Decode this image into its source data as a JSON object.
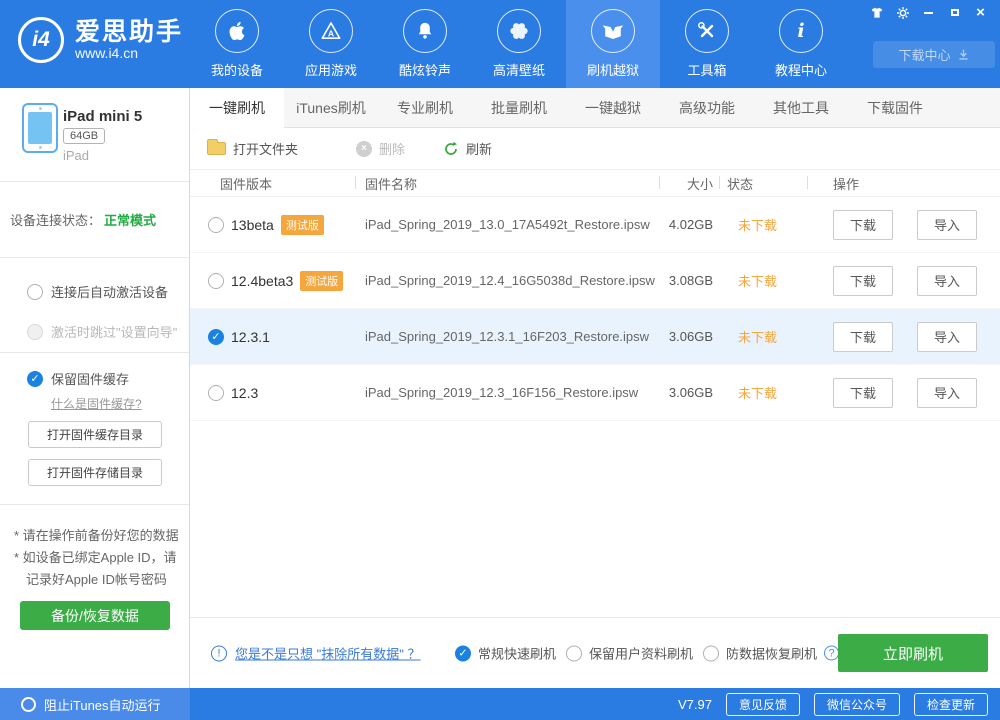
{
  "colors": {
    "accent_blue": "#2b7ce2",
    "nav_active_blue": "#4a8feb",
    "green": "#3cac46",
    "orange": "#f5a63c",
    "status_green": "#23ab44",
    "link_blue": "#3a7ad9",
    "selected_row": "#e9f3fd"
  },
  "header": {
    "brand": {
      "name": "爱思助手",
      "url": "www.i4.cn",
      "logo_text": "i4"
    },
    "nav": [
      {
        "label": "我的设备"
      },
      {
        "label": "应用游戏"
      },
      {
        "label": "酷炫铃声"
      },
      {
        "label": "高清壁纸"
      },
      {
        "label": "刷机越狱"
      },
      {
        "label": "工具箱"
      },
      {
        "label": "教程中心"
      }
    ],
    "download_center": "下载中心"
  },
  "sidebar": {
    "device": {
      "name": "iPad mini 5",
      "capacity": "64GB",
      "family": "iPad"
    },
    "connection_label": "设备连接状态：",
    "connection_status": "正常模式",
    "opt_auto_activate": "连接后自动激活设备",
    "opt_skip_wizard": "激活时跳过\"设置向导\"",
    "opt_keep_cache": "保留固件缓存",
    "cache_help_link": "什么是固件缓存?",
    "open_cache_btn": "打开固件缓存目录",
    "open_storage_btn": "打开固件存储目录",
    "note1": "* 请在操作前备份好您的数据",
    "note2": "* 如设备已绑定Apple ID，请",
    "note3": "记录好Apple ID帐号密码",
    "backup_btn": "备份/恢复数据",
    "block_itunes": "阻止iTunes自动运行"
  },
  "tabs": [
    {
      "label": "一键刷机"
    },
    {
      "label": "iTunes刷机"
    },
    {
      "label": "专业刷机"
    },
    {
      "label": "批量刷机"
    },
    {
      "label": "一键越狱"
    },
    {
      "label": "高级功能"
    },
    {
      "label": "其他工具"
    },
    {
      "label": "下载固件"
    }
  ],
  "toolbar": {
    "open_folder": "打开文件夹",
    "delete": "删除",
    "refresh": "刷新"
  },
  "table": {
    "col_version": "固件版本",
    "col_name": "固件名称",
    "col_size": "大小",
    "col_status": "状态",
    "col_action": "操作",
    "download_btn": "下载",
    "import_btn": "导入",
    "rows": [
      {
        "version": "13beta",
        "badge": "测试版",
        "name": "iPad_Spring_2019_13.0_17A5492t_Restore.ipsw",
        "size": "4.02GB",
        "status": "未下载"
      },
      {
        "version": "12.4beta3",
        "badge": "测试版",
        "name": "iPad_Spring_2019_12.4_16G5038d_Restore.ipsw",
        "size": "3.08GB",
        "status": "未下载"
      },
      {
        "version": "12.3.1",
        "name": "iPad_Spring_2019_12.3.1_16F203_Restore.ipsw",
        "size": "3.06GB",
        "status": "未下载"
      },
      {
        "version": "12.3",
        "name": "iPad_Spring_2019_12.3_16F156_Restore.ipsw",
        "size": "3.06GB",
        "status": "未下载"
      }
    ]
  },
  "footer": {
    "erase_link": "您是不是只想 \"抹除所有数据\" ？",
    "mode_fast": "常规快速刷机",
    "mode_keep": "保留用户资料刷机",
    "mode_secure": "防数据恢复刷机",
    "flash_btn": "立即刷机"
  },
  "statusbar": {
    "version": "V7.97",
    "feedback": "意见反馈",
    "wechat": "微信公众号",
    "update": "检查更新"
  }
}
